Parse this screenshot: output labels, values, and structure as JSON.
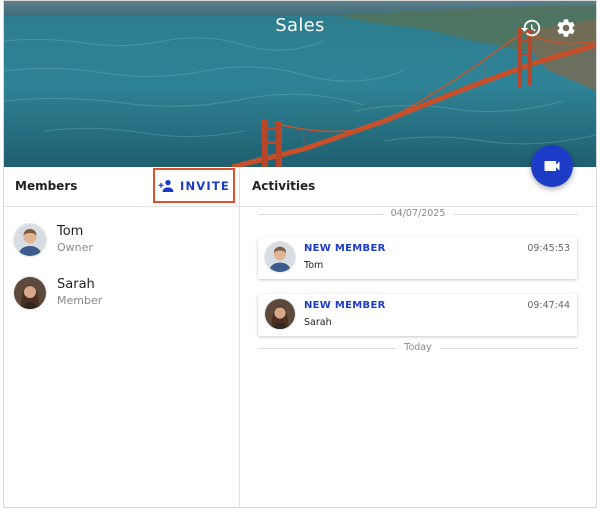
{
  "header": {
    "title": "Sales",
    "icons": [
      "history-icon",
      "settings-icon"
    ]
  },
  "fab": {
    "icon": "video-camera-icon",
    "color": "#1c3cc7"
  },
  "members_panel": {
    "title": "Members",
    "invite_label": "INVITE",
    "invite_icon": "person-add-icon",
    "members": [
      {
        "name": "Tom",
        "role": "Owner"
      },
      {
        "name": "Sarah",
        "role": "Member"
      }
    ]
  },
  "activities_panel": {
    "title": "Activities",
    "date_separator": "04/07/2025",
    "today_separator": "Today",
    "items": [
      {
        "type": "NEW MEMBER",
        "name": "Tom",
        "time": "09:45:53"
      },
      {
        "type": "NEW MEMBER",
        "name": "Sarah",
        "time": "09:47:44"
      }
    ]
  },
  "colors": {
    "accent": "#1c3cc7",
    "highlight": "#e0502a"
  }
}
